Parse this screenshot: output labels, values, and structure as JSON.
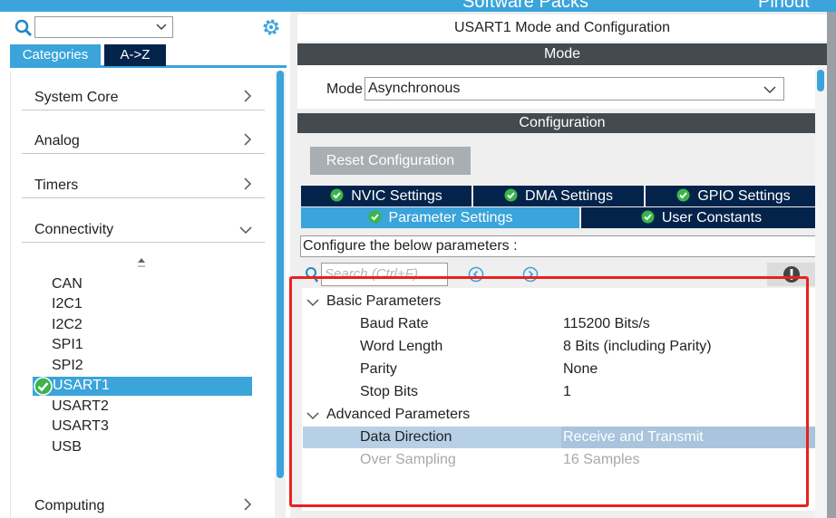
{
  "topbar": {
    "software_packs": "Software Packs",
    "pinout": "Pinout"
  },
  "left": {
    "search": {
      "value": ""
    },
    "tabs": [
      {
        "label": "Categories",
        "active": true
      },
      {
        "label": "A->Z",
        "active": false
      }
    ],
    "categories": [
      {
        "label": "System Core",
        "expanded": false
      },
      {
        "label": "Analog",
        "expanded": false
      },
      {
        "label": "Timers",
        "expanded": false
      },
      {
        "label": "Connectivity",
        "expanded": true
      },
      {
        "label": "Computing",
        "expanded": false
      }
    ],
    "peripherals": [
      "CAN",
      "I2C1",
      "I2C2",
      "SPI1",
      "SPI2",
      "USART1",
      "USART2",
      "USART3",
      "USB"
    ],
    "selected_peripheral": "USART1"
  },
  "right": {
    "title": "USART1 Mode and Configuration",
    "mode_section": "Mode",
    "mode_label": "Mode",
    "mode_value": "Asynchronous",
    "config_section": "Configuration",
    "reset_label": "Reset Configuration",
    "tabs_row1": [
      "NVIC Settings",
      "DMA Settings",
      "GPIO Settings"
    ],
    "tabs_row2": [
      "Parameter Settings",
      "User Constants"
    ],
    "active_tab": "Parameter Settings",
    "configure_text": "Configure the below parameters :",
    "search_placeholder": "Search (Ctrl+F)",
    "groups": [
      {
        "label": "Basic Parameters",
        "params": [
          {
            "name": "Baud Rate",
            "value": "115200 Bits/s"
          },
          {
            "name": "Word Length",
            "value": "8 Bits (including Parity)"
          },
          {
            "name": "Parity",
            "value": "None"
          },
          {
            "name": "Stop Bits",
            "value": "1"
          }
        ]
      },
      {
        "label": "Advanced Parameters",
        "params": [
          {
            "name": "Data Direction",
            "value": "Receive and Transmit",
            "selected": true
          },
          {
            "name": "Over Sampling",
            "value": "16 Samples",
            "disabled": true
          }
        ]
      }
    ]
  },
  "colors": {
    "accent": "#3aa4db",
    "navy": "#03234b",
    "section_header": "#444b4f",
    "check": "#39b54a",
    "highlight": "#e8221f"
  }
}
